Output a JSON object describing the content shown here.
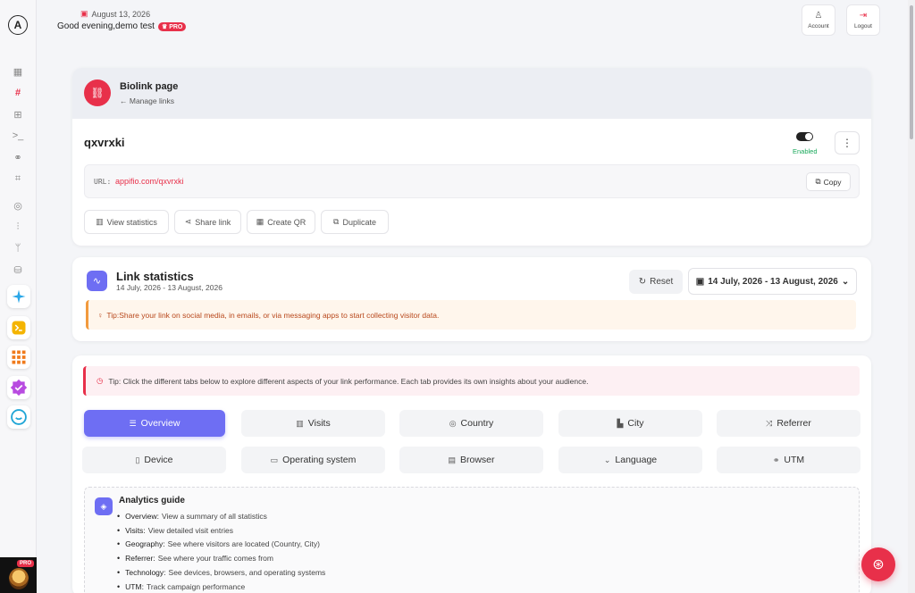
{
  "header": {
    "date": "August 13, 2026",
    "greeting": "Good evening,demo test",
    "badge": "PRO",
    "account_label": "Account",
    "logout_label": "Logout"
  },
  "sidebar": {
    "avatar_badge": "PRO",
    "items": [
      "dashboard-icon",
      "hashtag-icon",
      "grid-icon",
      "terminal-icon",
      "link-icon",
      "qr-icon",
      "globe-icon",
      "sliders-icon",
      "branch-icon",
      "database-icon"
    ],
    "apps": [
      "sparkle-app",
      "terminal-app",
      "grid-app",
      "badge-app",
      "chat-app"
    ]
  },
  "biolink": {
    "page_title": "Biolink page",
    "back_label": "Manage links",
    "link_name": "qxvrxki",
    "status_label": "Enabled",
    "enabled": true,
    "url_label": "URL:",
    "url_value": "appifio.com/qxvrxki",
    "copy_label": "Copy",
    "actions": [
      "View statistics",
      "Share link",
      "Create QR",
      "Duplicate"
    ]
  },
  "stats": {
    "title": "Link statistics",
    "range": "14 July, 2026 - 13 August, 2026",
    "reset_label": "Reset",
    "date_button": "14 July, 2026 - 13 August, 2026",
    "tip": "Tip:Share your link on social media, in emails, or via messaging apps to start collecting visitor data."
  },
  "analytics": {
    "tip": "Tip: Click the different tabs below to explore different aspects of your link performance. Each tab provides its own insights about your audience.",
    "tabs": [
      "Overview",
      "Visits",
      "Country",
      "City",
      "Referrer",
      "Device",
      "Operating system",
      "Browser",
      "Language",
      "UTM"
    ],
    "active_tab": "Overview",
    "guide_title": "Analytics guide",
    "guide": [
      {
        "key": "Overview:",
        "text": "View a summary of all statistics"
      },
      {
        "key": "Visits:",
        "text": "View detailed visit entries"
      },
      {
        "key": "Geography:",
        "text": "See where visitors are located (Country, City)"
      },
      {
        "key": "Referrer:",
        "text": "See where your traffic comes from"
      },
      {
        "key": "Technology:",
        "text": "See devices, browsers, and operating systems"
      },
      {
        "key": "UTM:",
        "text": "Track campaign performance"
      }
    ]
  },
  "colors": {
    "accent": "#e8304a",
    "primary": "#6e6ef3",
    "success": "#18a85a",
    "tip_orange": "#f29a3d"
  }
}
